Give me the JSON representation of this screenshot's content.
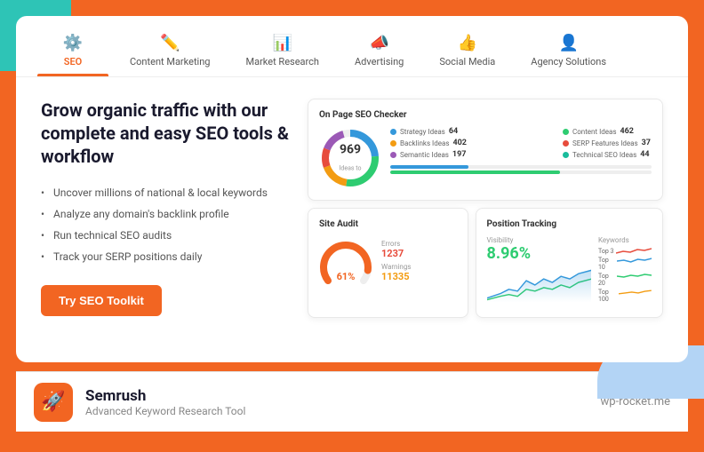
{
  "background_color": "#f26522",
  "card": {
    "nav": {
      "tabs": [
        {
          "id": "seo",
          "label": "SEO",
          "active": true,
          "icon": "⚙"
        },
        {
          "id": "content-marketing",
          "label": "Content Marketing",
          "active": false,
          "icon": "✏"
        },
        {
          "id": "market-research",
          "label": "Market Research",
          "active": false,
          "icon": "📊"
        },
        {
          "id": "advertising",
          "label": "Advertising",
          "active": false,
          "icon": "📣"
        },
        {
          "id": "social-media",
          "label": "Social Media",
          "active": false,
          "icon": "👍"
        },
        {
          "id": "agency-solutions",
          "label": "Agency Solutions",
          "active": false,
          "icon": "👤"
        }
      ]
    },
    "hero": {
      "heading": "Grow organic traffic with our complete and easy SEO tools & workflow",
      "features": [
        "Uncover millions of national & local keywords",
        "Analyze any domain's backlink profile",
        "Run technical SEO audits",
        "Track your SERP positions daily"
      ],
      "cta_label": "Try SEO Toolkit"
    },
    "on_page_seo": {
      "title": "On Page SEO Checker",
      "donut_value": "969",
      "donut_sub": "Ideas to",
      "items": [
        {
          "label": "Strategy Ideas",
          "value": "64",
          "color": "#3498db"
        },
        {
          "label": "Content Ideas",
          "value": "462",
          "color": "#2ecc71"
        },
        {
          "label": "Backlinks Ideas",
          "value": "402",
          "color": "#f39c12"
        },
        {
          "label": "SERP Features Ideas",
          "value": "37",
          "color": "#e74c3c"
        },
        {
          "label": "Semantic Ideas",
          "value": "197",
          "color": "#9b59b6"
        },
        {
          "label": "Technical SEO Ideas",
          "value": "44",
          "color": "#1abc9c"
        }
      ]
    },
    "site_audit": {
      "title": "Site Audit",
      "gauge_percent": "61%",
      "errors_label": "Errors",
      "errors_value": "1237",
      "warnings_label": "Warnings",
      "warnings_value": "11335"
    },
    "position_tracking": {
      "title": "Position Tracking",
      "visibility_label": "Visibility",
      "visibility_value": "8.96%",
      "keywords_label": "Keywords",
      "keyword_items": [
        {
          "label": "Top 3",
          "line": true
        },
        {
          "label": "Top 10",
          "line": true
        },
        {
          "label": "Top 20",
          "line": true
        },
        {
          "label": "Top 100",
          "line": true
        }
      ]
    }
  },
  "footer": {
    "name": "Semrush",
    "description": "Advanced Keyword Research Tool",
    "url": "wp-rocket.me",
    "logo_icon": "🚀"
  }
}
